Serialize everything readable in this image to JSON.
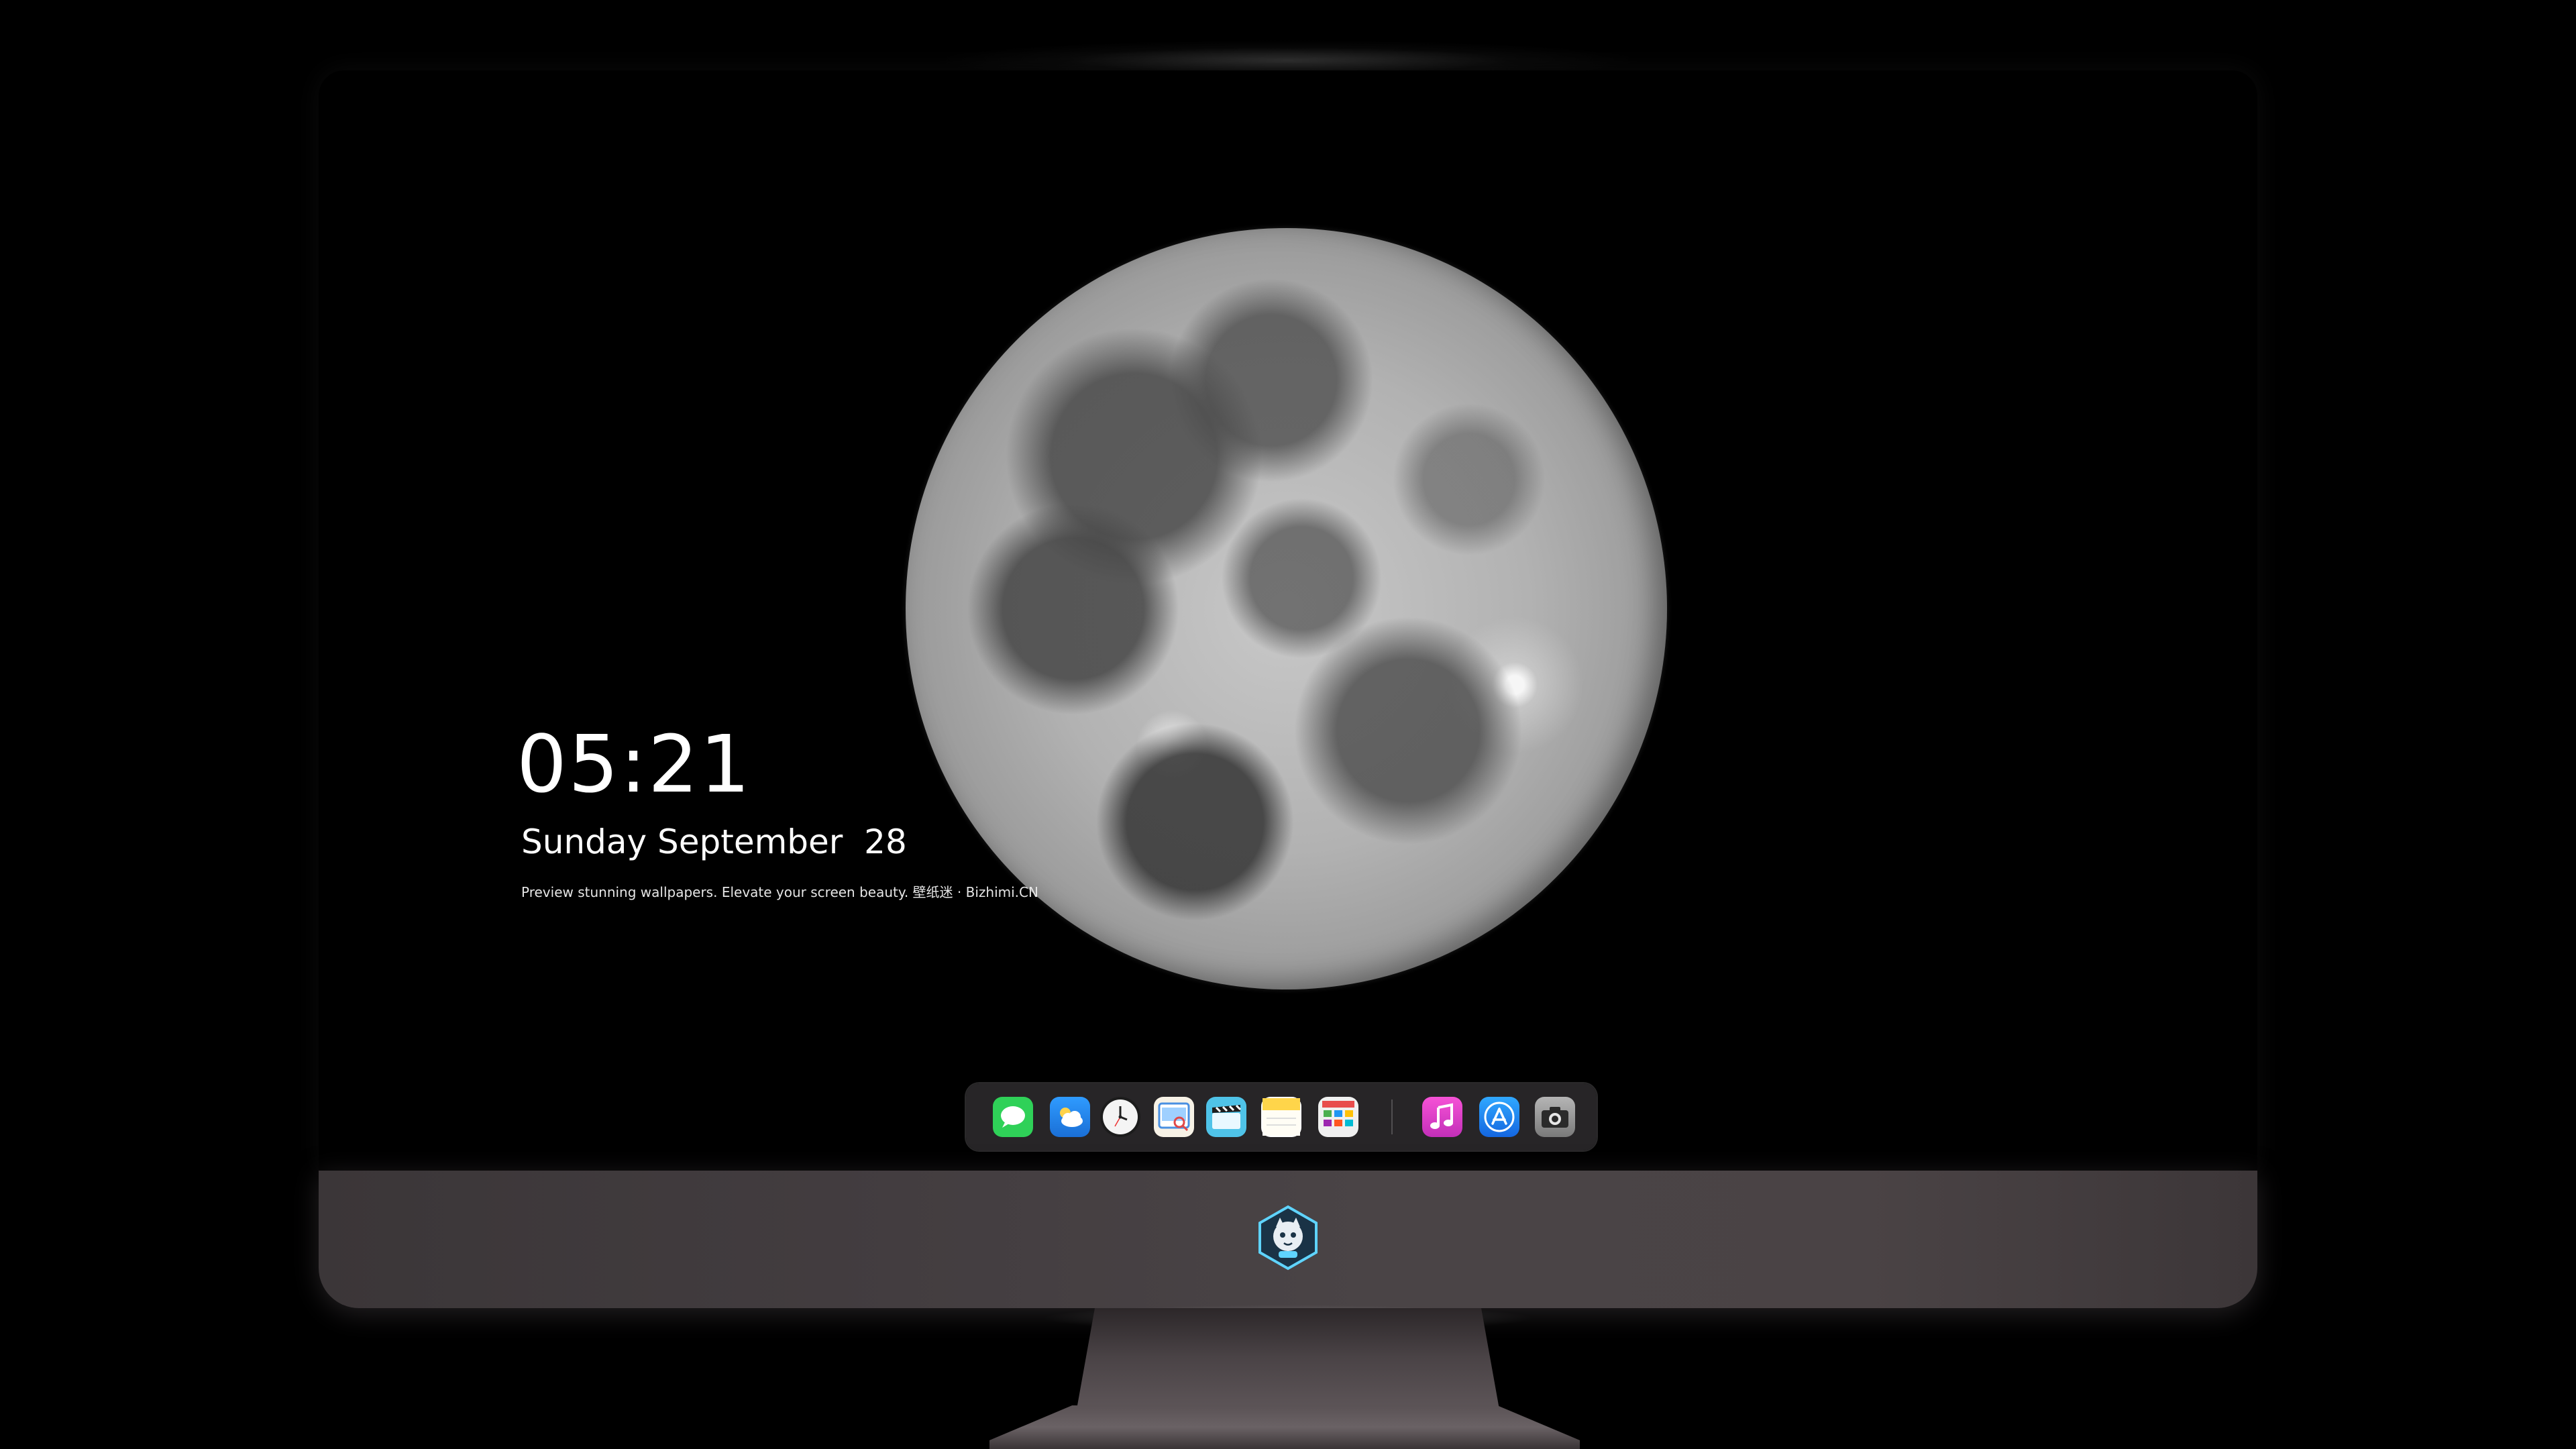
{
  "lockscreen": {
    "time": "05:21",
    "date": "Sunday September  28",
    "tagline": "Preview stunning wallpapers. Elevate your screen beauty. 壁纸迷 · Bizhimi.CN"
  },
  "dock": {
    "apps": [
      {
        "name": "messages",
        "icon": "chat-bubble-icon",
        "color": "#2fd158"
      },
      {
        "name": "weather",
        "icon": "cloud-icon",
        "color": "#2d8cf0"
      },
      {
        "name": "clock",
        "icon": "clock-icon",
        "color": "#f2f2f2"
      },
      {
        "name": "preview",
        "icon": "photo-viewer-icon",
        "color": "#f5c542"
      },
      {
        "name": "clips",
        "icon": "clapperboard-icon",
        "color": "#4fc3e8"
      },
      {
        "name": "notes",
        "icon": "notepad-icon",
        "color": "#ffd54a"
      },
      {
        "name": "calendar",
        "icon": "grid-calendar-icon",
        "color": "#e8e8e8"
      },
      {
        "name": "music",
        "icon": "music-note-icon",
        "color": "#e040c8"
      },
      {
        "name": "app-store",
        "icon": "app-store-icon",
        "color": "#1e90ff"
      },
      {
        "name": "camera",
        "icon": "camera-icon",
        "color": "#8a8a8a"
      }
    ]
  },
  "colors": {
    "background": "#000000",
    "chin": "#433d40",
    "dock": "#2a282a",
    "text": "#ffffff"
  }
}
